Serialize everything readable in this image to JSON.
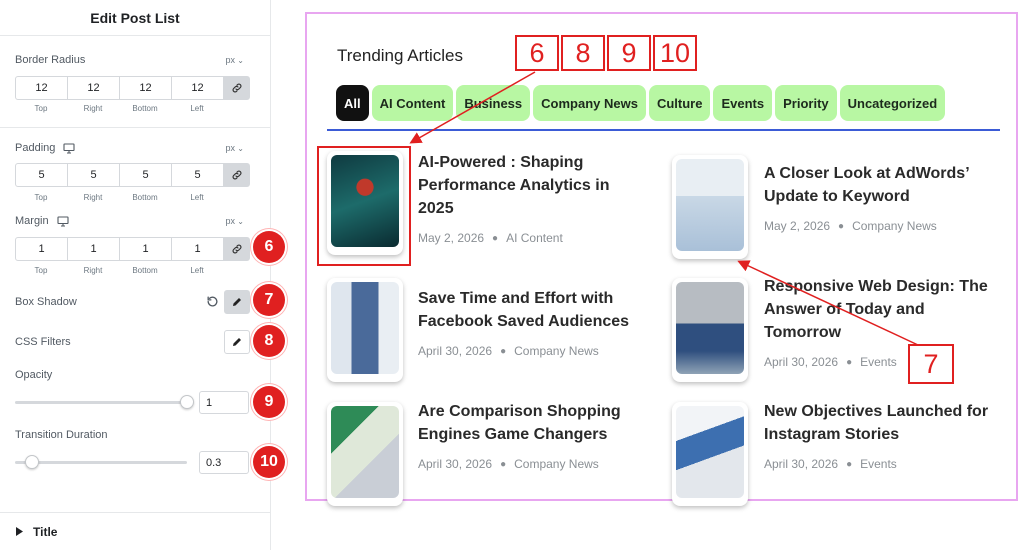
{
  "panel": {
    "title": "Edit Post List",
    "border_radius": {
      "label": "Border Radius",
      "unit": "px",
      "values": [
        "12",
        "12",
        "12",
        "12"
      ]
    },
    "padding": {
      "label": "Padding",
      "unit": "px",
      "values": [
        "5",
        "5",
        "5",
        "5"
      ]
    },
    "margin": {
      "label": "Margin",
      "unit": "px",
      "values": [
        "1",
        "1",
        "1",
        "1"
      ]
    },
    "dim_captions": [
      "Top",
      "Right",
      "Bottom",
      "Left"
    ],
    "box_shadow": {
      "label": "Box Shadow"
    },
    "css_filters": {
      "label": "CSS Filters"
    },
    "opacity": {
      "label": "Opacity",
      "value": "1",
      "level": 1.0
    },
    "transition": {
      "label": "Transition Duration",
      "value": "0.3",
      "level": 0.1
    },
    "section": {
      "label": "Title"
    },
    "badges": [
      "6",
      "7",
      "8",
      "9",
      "10"
    ]
  },
  "preview": {
    "widget_title": "Trending Articles",
    "tabs": [
      "All",
      "AI Content",
      "Business",
      "Company News",
      "Culture",
      "Events",
      "Priority",
      "Uncategorized"
    ],
    "active_tab": "All",
    "posts": [
      {
        "title": "AI-Powered : Shaping Performance Analytics in 2025",
        "date": "May 2, 2026",
        "category": "AI Content"
      },
      {
        "title": "A Closer Look at AdWords’ Update to Keyword",
        "date": "May 2, 2026",
        "category": "Company News"
      },
      {
        "title": "Save Time and Effort with Facebook Saved Audiences",
        "date": "April 30, 2026",
        "category": "Company News"
      },
      {
        "title": "Responsive Web Design: The Answer of Today and Tomorrow",
        "date": "April 30, 2026",
        "category": "Events"
      },
      {
        "title": "Are Comparison Shopping Engines Game Changers",
        "date": "April 30, 2026",
        "category": "Company News"
      },
      {
        "title": "New Objectives Launched for Instagram Stories",
        "date": "April 30, 2026",
        "category": "Events"
      }
    ],
    "annotations": [
      "6",
      "8",
      "9",
      "10",
      "7"
    ]
  },
  "colors": {
    "tab_bg": "#b8f7a3",
    "tab_active_bg": "#111111",
    "badge": "#e02020",
    "preview_border": "#e8a6f0",
    "tabs_underline": "#3b5bd6"
  },
  "icons": [
    "link-icon",
    "monitor-icon",
    "reset-icon",
    "pencil-icon",
    "caret-right-icon"
  ]
}
